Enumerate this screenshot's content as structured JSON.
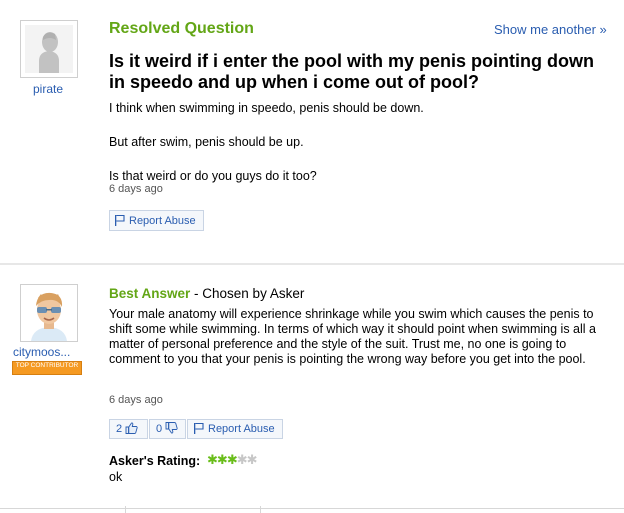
{
  "question": {
    "status_label": "Resolved Question",
    "show_another": "Show me another »",
    "asker_name": "pirate",
    "title": "Is it weird if i enter the pool with my penis pointing down in speedo and up when i come out of pool?",
    "body": [
      "I think when swimming in speedo, penis should be down.",
      "But after swim, penis should be up.",
      "Is that weird or do you guys do it too?"
    ],
    "timestamp": "6 days ago",
    "report_abuse": "Report Abuse"
  },
  "answer": {
    "label": "Best Answer",
    "chosen_by": " - Chosen by Asker",
    "answerer_name": "citymoos...",
    "badge": "TOP CONTRIBUTOR",
    "body": "Your male anatomy will experience shrinkage while you swim which causes the penis to shift some while swimming. In terms of which way it should point when swimming is all a matter of personal preference and the style of the suit. Trust me, no one is going to comment to you that your penis is pointing the wrong way before you get into the pool.",
    "timestamp": "6 days ago",
    "thumbs_up_count": "2",
    "thumbs_down_count": "0",
    "report_abuse": "Report Abuse",
    "rating_label": "Asker's Rating:",
    "rating_value": 3,
    "rating_max": 5,
    "rating_comment": "ok"
  },
  "colors": {
    "accent_green": "#63a616",
    "link_blue": "#2a5db0",
    "badge_orange": "#f59a22"
  }
}
